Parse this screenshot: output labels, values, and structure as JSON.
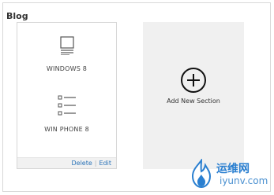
{
  "section": {
    "title": "Blog"
  },
  "blog_card": {
    "platforms": [
      {
        "label": "WINDOWS 8",
        "icon": "document-icon"
      },
      {
        "label": "WIN PHONE 8",
        "icon": "list-icon"
      }
    ],
    "footer": {
      "delete_label": "Delete",
      "separator": "|",
      "edit_label": "Edit"
    }
  },
  "add_card": {
    "label": "Add New Section",
    "icon": "plus-circle-icon"
  },
  "watermark": {
    "cn": "运维网",
    "en": "iyunv.com"
  },
  "colors": {
    "link": "#2a73b8",
    "add_card_bg": "#f0f0f0",
    "footer_bg": "#f1f1f1"
  }
}
